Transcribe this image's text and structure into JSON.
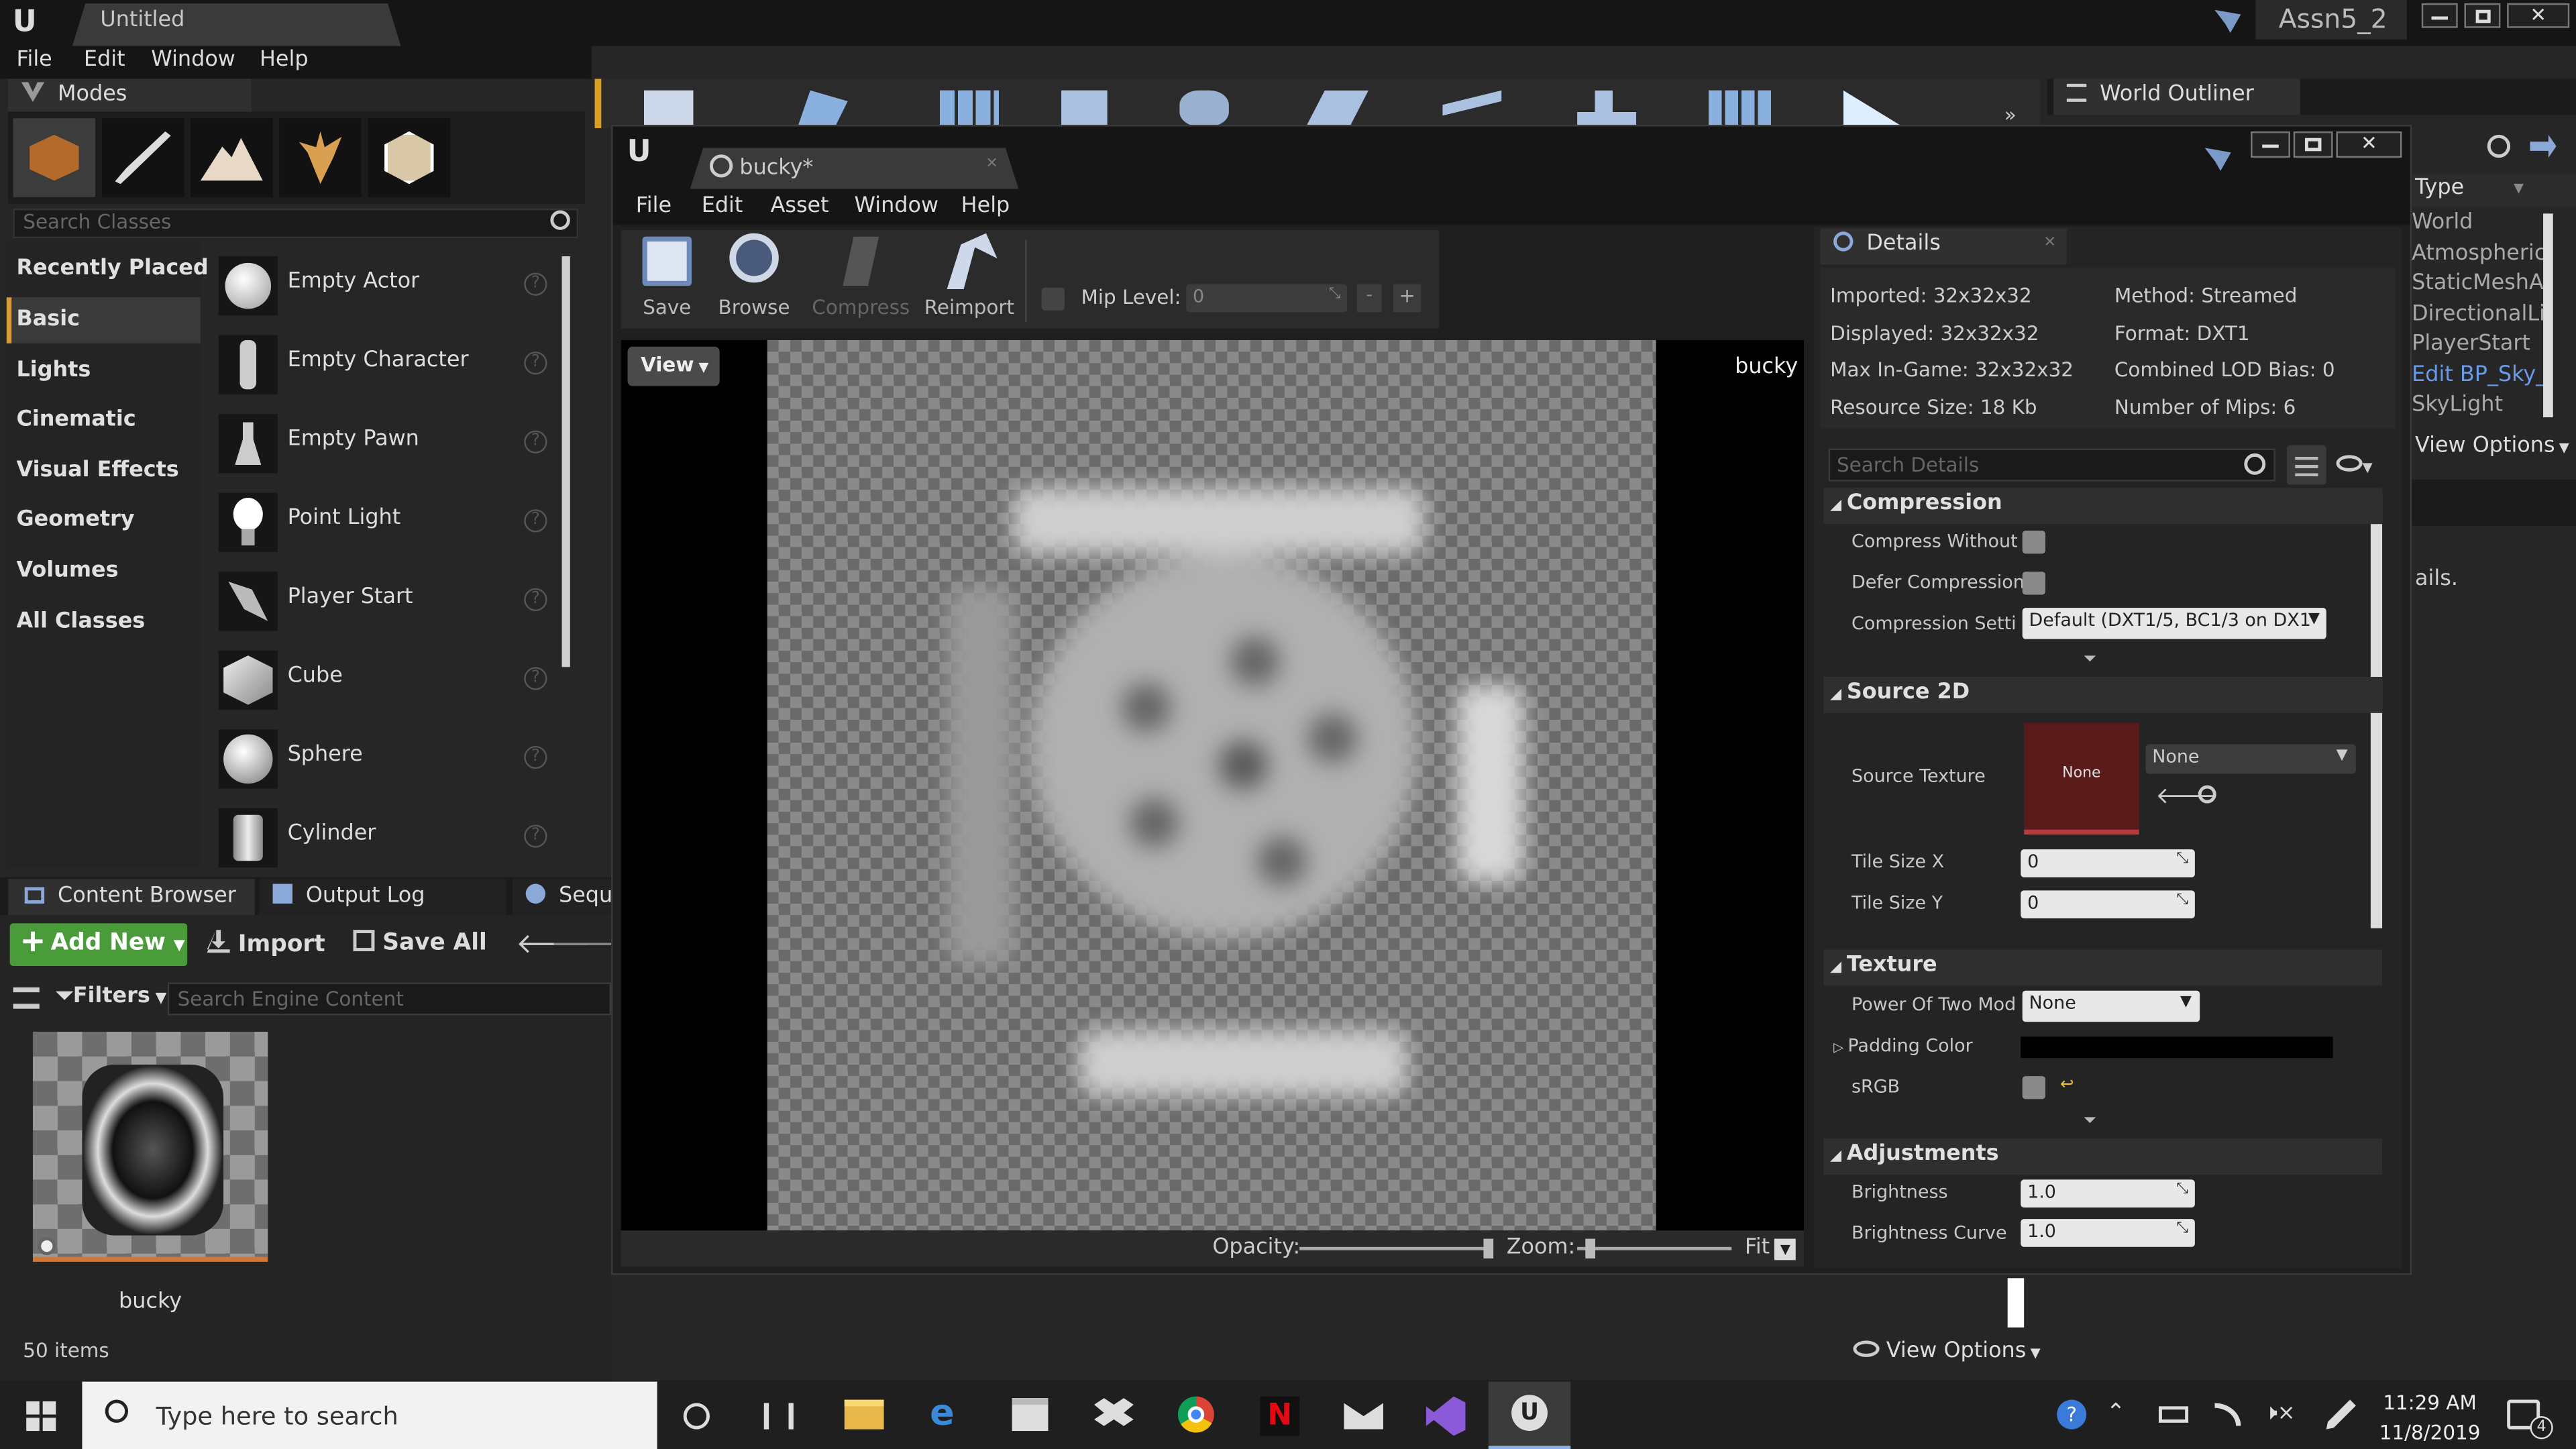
{
  "main_window": {
    "tab_title": "Untitled",
    "project_name": "Assn5_2",
    "menu": [
      "File",
      "Edit",
      "Window",
      "Help"
    ]
  },
  "modes_panel": {
    "title": "Modes",
    "search_placeholder": "Search Classes",
    "categories": [
      "Recently Placed",
      "Basic",
      "Lights",
      "Cinematic",
      "Visual Effects",
      "Geometry",
      "Volumes",
      "All Classes"
    ],
    "selected_category": "Basic",
    "items": [
      "Empty Actor",
      "Empty Character",
      "Empty Pawn",
      "Point Light",
      "Player Start",
      "Cube",
      "Sphere",
      "Cylinder"
    ]
  },
  "bottom_tabs": [
    "Content Browser",
    "Output Log",
    "Sequ"
  ],
  "content_browser": {
    "add_new": "Add New",
    "import": "Import",
    "save_all": "Save All",
    "filters": "Filters",
    "search_placeholder": "Search Engine Content",
    "asset_name": "bucky",
    "item_count": "50 items",
    "view_options": "View Options"
  },
  "world_outliner": {
    "title": "World Outliner",
    "type_header": "Type",
    "items": [
      "World",
      "AtmosphericF",
      "StaticMeshAc",
      "DirectionalLig",
      "PlayerStart",
      "Edit BP_Sky_",
      "SkyLight"
    ],
    "view_options": "View Options",
    "details_text": "ails."
  },
  "texture_editor": {
    "tab_title": "bucky*",
    "menu": [
      "File",
      "Edit",
      "Asset",
      "Window",
      "Help"
    ],
    "toolbar": {
      "save": "Save",
      "browse": "Browse",
      "compress": "Compress",
      "reimport": "Reimport",
      "mip_label": "Mip Level:",
      "mip_value": "0",
      "minus": "-",
      "plus": "+"
    },
    "viewport": {
      "view_button": "View",
      "asset_label": "bucky",
      "opacity_label": "Opacity:",
      "zoom_label": "Zoom:",
      "fit": "Fit",
      "opacity": 1.0
    }
  },
  "details": {
    "title": "Details",
    "info_left": [
      "Imported: 32x32x32",
      "Displayed: 32x32x32",
      "Max In-Game: 32x32x32",
      "Resource Size: 18 Kb"
    ],
    "info_right": [
      "Method: Streamed",
      "Format: DXT1",
      "Combined LOD Bias: 0",
      "Number of Mips: 6"
    ],
    "search_placeholder": "Search Details",
    "compression": {
      "header": "Compression",
      "compress_without": "Compress Without",
      "defer_compression": "Defer Compression",
      "compression_settings": "Compression Setti",
      "compression_value": "Default (DXT1/5, BC1/3 on DX1"
    },
    "source2d": {
      "header": "Source 2D",
      "source_texture": "Source Texture",
      "thumb_label": "None",
      "dropdown_value": "None",
      "tile_x": "Tile Size X",
      "tile_x_value": "0",
      "tile_y": "Tile Size Y",
      "tile_y_value": "0"
    },
    "texture": {
      "header": "Texture",
      "power_of_two": "Power Of Two Mod",
      "power_value": "None",
      "padding_color": "Padding Color",
      "srgb": "sRGB"
    },
    "adjustments": {
      "header": "Adjustments",
      "brightness": "Brightness",
      "brightness_value": "1.0",
      "brightness_curve": "Brightness Curve",
      "brightness_curve_value": "1.0"
    }
  },
  "taskbar": {
    "search_placeholder": "Type here to search",
    "time": "11:29 AM",
    "date": "11/8/2019",
    "notification_count": "4"
  },
  "colors": {
    "accent_green": "#4a9b3a",
    "source_texture_red": "#5a1a1a",
    "selection_blue": "#5a7ab8"
  }
}
